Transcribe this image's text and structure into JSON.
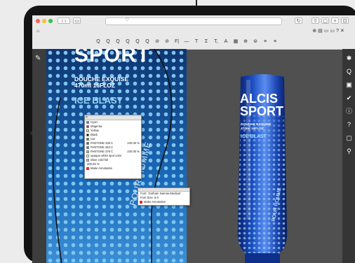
{
  "toolbar": {
    "tools": [
      "Q",
      "Q",
      "Q",
      "Q",
      "Q",
      "Q",
      "⊘",
      "⊘",
      "F|",
      "—",
      "T",
      "Σ",
      "T,",
      "A",
      "▦",
      "⊕",
      "⊜",
      "≡",
      "≡"
    ]
  },
  "separations": {
    "items": [
      {
        "name": "Cyan",
        "color": "#00a0e3"
      },
      {
        "name": "Magenta",
        "color": "#e6007e"
      },
      {
        "name": "Yellow",
        "color": "#ffec00"
      },
      {
        "name": "Black",
        "color": "#111111"
      },
      {
        "name": "Cut",
        "color": "#2a8a3a"
      },
      {
        "name": "PANTONE 335 C",
        "color": "#00816d",
        "value": "100.00 %"
      },
      {
        "name": "PANTONE 354 C",
        "color": "#00b140"
      },
      {
        "name": "PANTONE 375 C",
        "color": "#97d700",
        "value": "100.00 %"
      },
      {
        "name": "opaque white spot color",
        "color": "#f4f4f4"
      },
      {
        "name": "silver cold foil",
        "color": "#b8b8b8"
      }
    ],
    "total": "200.00 %",
    "annotation": "Make Annotation"
  },
  "font_info": {
    "font": "Font: 'Gotham Narrow-Medium'",
    "size": "Font Size: 6.0",
    "annotation": "Make Annotation"
  },
  "label": {
    "sport": "SPORT",
    "douche": "DOUCHE EXQUISE",
    "volume": "470ml 16FLOZ",
    "ice": "ICE BLAST",
    "pour": "POUR HOMME"
  },
  "bottle": {
    "brand1": "ALCIS",
    "brand2": "SPORT",
    "douche": "DOUCHE EXQUISE",
    "volume": "470ml 16FLOZ",
    "ice": "ICE BLAST",
    "pour": "POUR HOMME"
  },
  "right_tools": [
    "✱",
    "Q",
    "▣",
    "✔",
    "ⓘ",
    "?",
    "▢",
    "⚲"
  ],
  "colors": {
    "accent_blue": "#1a69b8",
    "panel_bg": "#505050"
  }
}
